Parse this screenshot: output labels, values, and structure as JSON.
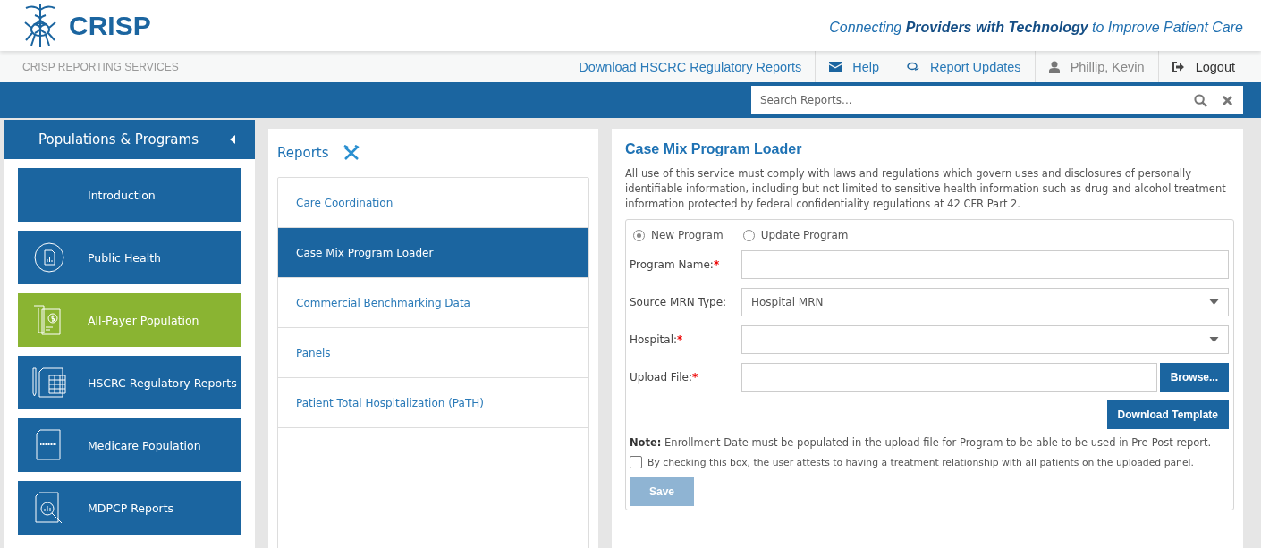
{
  "header": {
    "logo_text": "CRISP",
    "tagline": "Connecting **Providers with Technology** to Improve Patient Care"
  },
  "nav": {
    "title": "CRISP REPORTING SERVICES",
    "items": [
      {
        "kind": "link",
        "label": "Download HSCRC Regulatory Reports"
      },
      {
        "kind": "help",
        "label": "Help"
      },
      {
        "kind": "updates",
        "label": "Report Updates"
      },
      {
        "kind": "user",
        "label": "Phillip, Kevin"
      },
      {
        "kind": "logout",
        "label": "Logout"
      }
    ]
  },
  "search": {
    "placeholder": "Search Reports..."
  },
  "sidebar": {
    "title": "Populations & Programs",
    "items": [
      {
        "label": "Introduction",
        "selected": false
      },
      {
        "label": "Public Health",
        "selected": false
      },
      {
        "label": "All-Payer Population",
        "selected": true
      },
      {
        "label": "HSCRC Regulatory Reports",
        "selected": false
      },
      {
        "label": "Medicare Population",
        "selected": false
      },
      {
        "label": "MDPCP Reports",
        "selected": false
      }
    ]
  },
  "reports": {
    "title": "Reports",
    "items": [
      {
        "label": "Care Coordination",
        "selected": false
      },
      {
        "label": "Case Mix Program Loader",
        "selected": true
      },
      {
        "label": "Commercial Benchmarking Data",
        "selected": false
      },
      {
        "label": "Panels",
        "selected": false
      },
      {
        "label": "Patient Total Hospitalization (PaTH)",
        "selected": false
      }
    ]
  },
  "form": {
    "title": "Case Mix Program Loader",
    "disclaimer": "All use of this service must comply with laws and regulations which govern uses and disclosures of personally identifiable information, including but not limited to sensitive health information such as drug and alcohol treatment information protected by federal confidentiality regulations at 42 CFR Part 2.",
    "radios": [
      {
        "label": "New Program",
        "selected": true
      },
      {
        "label": "Update Program",
        "selected": false
      }
    ],
    "fields": [
      {
        "kind": "text",
        "label": "Program Name:",
        "required": true
      },
      {
        "kind": "select",
        "label": "Source MRN Type:",
        "required": false,
        "value": "Hospital MRN"
      },
      {
        "kind": "select",
        "label": "Hospital:",
        "required": true
      },
      {
        "kind": "file",
        "label": "Upload File:",
        "required": true,
        "button": "Browse..."
      }
    ],
    "required_mark": "*",
    "template_button": "Download Template",
    "note": "**Note:** Enrollment Date must be populated in the upload file for Program to be able to be used in Pre-Post report.",
    "attest": {
      "label": "By checking this box, the user attests to having a treatment relationship with all patients on the uploaded panel.",
      "checked": false
    },
    "save": {
      "label": "Save",
      "disabled": true
    }
  }
}
